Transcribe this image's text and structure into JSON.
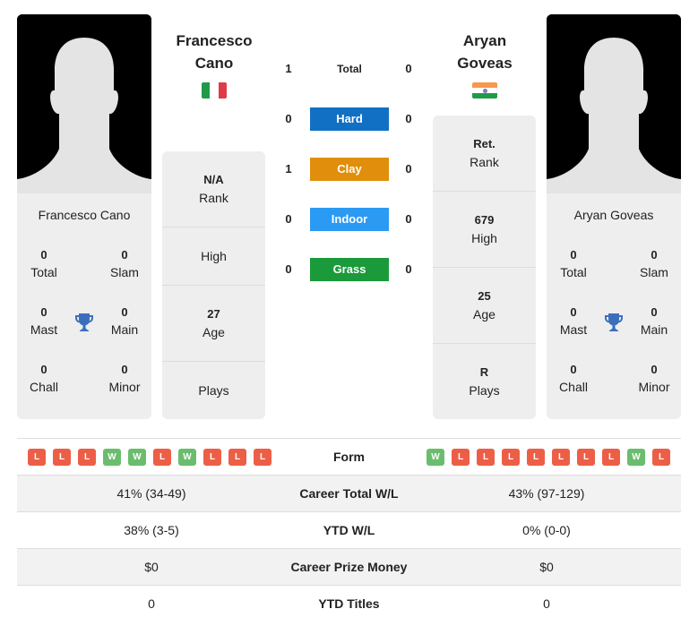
{
  "colors": {
    "hard": "#1170c4",
    "clay": "#e08e0b",
    "indoor": "#2b9af3",
    "grass": "#1a9a3a",
    "win": "#6bbd6e",
    "loss": "#ec5f46",
    "trophy": "#3b6fbd"
  },
  "player1": {
    "name_line1": "Francesco",
    "name_line2": "Cano",
    "full_name": "Francesco Cano",
    "flag": "italy-flag",
    "titles": {
      "total": {
        "value": "0",
        "label": "Total"
      },
      "slam": {
        "value": "0",
        "label": "Slam"
      },
      "mast": {
        "value": "0",
        "label": "Mast"
      },
      "main": {
        "value": "0",
        "label": "Main"
      },
      "chall": {
        "value": "0",
        "label": "Chall"
      },
      "minor": {
        "value": "0",
        "label": "Minor"
      }
    },
    "stats": {
      "rank": {
        "value": "N/A",
        "label": "Rank"
      },
      "high": {
        "value": "",
        "label": "High"
      },
      "age": {
        "value": "27",
        "label": "Age"
      },
      "plays": {
        "value": "",
        "label": "Plays"
      }
    },
    "form": [
      "L",
      "L",
      "L",
      "W",
      "W",
      "L",
      "W",
      "L",
      "L",
      "L"
    ]
  },
  "player2": {
    "name_line1": "Aryan",
    "name_line2": "Goveas",
    "full_name": "Aryan Goveas",
    "flag": "india-flag",
    "titles": {
      "total": {
        "value": "0",
        "label": "Total"
      },
      "slam": {
        "value": "0",
        "label": "Slam"
      },
      "mast": {
        "value": "0",
        "label": "Mast"
      },
      "main": {
        "value": "0",
        "label": "Main"
      },
      "chall": {
        "value": "0",
        "label": "Chall"
      },
      "minor": {
        "value": "0",
        "label": "Minor"
      }
    },
    "stats": {
      "rank": {
        "value": "Ret.",
        "label": "Rank"
      },
      "high": {
        "value": "679",
        "label": "High"
      },
      "age": {
        "value": "25",
        "label": "Age"
      },
      "plays": {
        "value": "R",
        "label": "Plays"
      }
    },
    "form": [
      "W",
      "L",
      "L",
      "L",
      "L",
      "L",
      "L",
      "L",
      "W",
      "L"
    ]
  },
  "h2h": [
    {
      "label": "Total",
      "p1": "1",
      "p2": "0",
      "surface": "total"
    },
    {
      "label": "Hard",
      "p1": "0",
      "p2": "0",
      "surface": "hard"
    },
    {
      "label": "Clay",
      "p1": "1",
      "p2": "0",
      "surface": "clay"
    },
    {
      "label": "Indoor",
      "p1": "0",
      "p2": "0",
      "surface": "indoor"
    },
    {
      "label": "Grass",
      "p1": "0",
      "p2": "0",
      "surface": "grass"
    }
  ],
  "comparison": [
    {
      "label": "Form",
      "p1": "",
      "p2": ""
    },
    {
      "label": "Career Total W/L",
      "p1": "41% (34-49)",
      "p2": "43% (97-129)"
    },
    {
      "label": "YTD W/L",
      "p1": "38% (3-5)",
      "p2": "0% (0-0)"
    },
    {
      "label": "Career Prize Money",
      "p1": "$0",
      "p2": "$0"
    },
    {
      "label": "YTD Titles",
      "p1": "0",
      "p2": "0"
    }
  ]
}
